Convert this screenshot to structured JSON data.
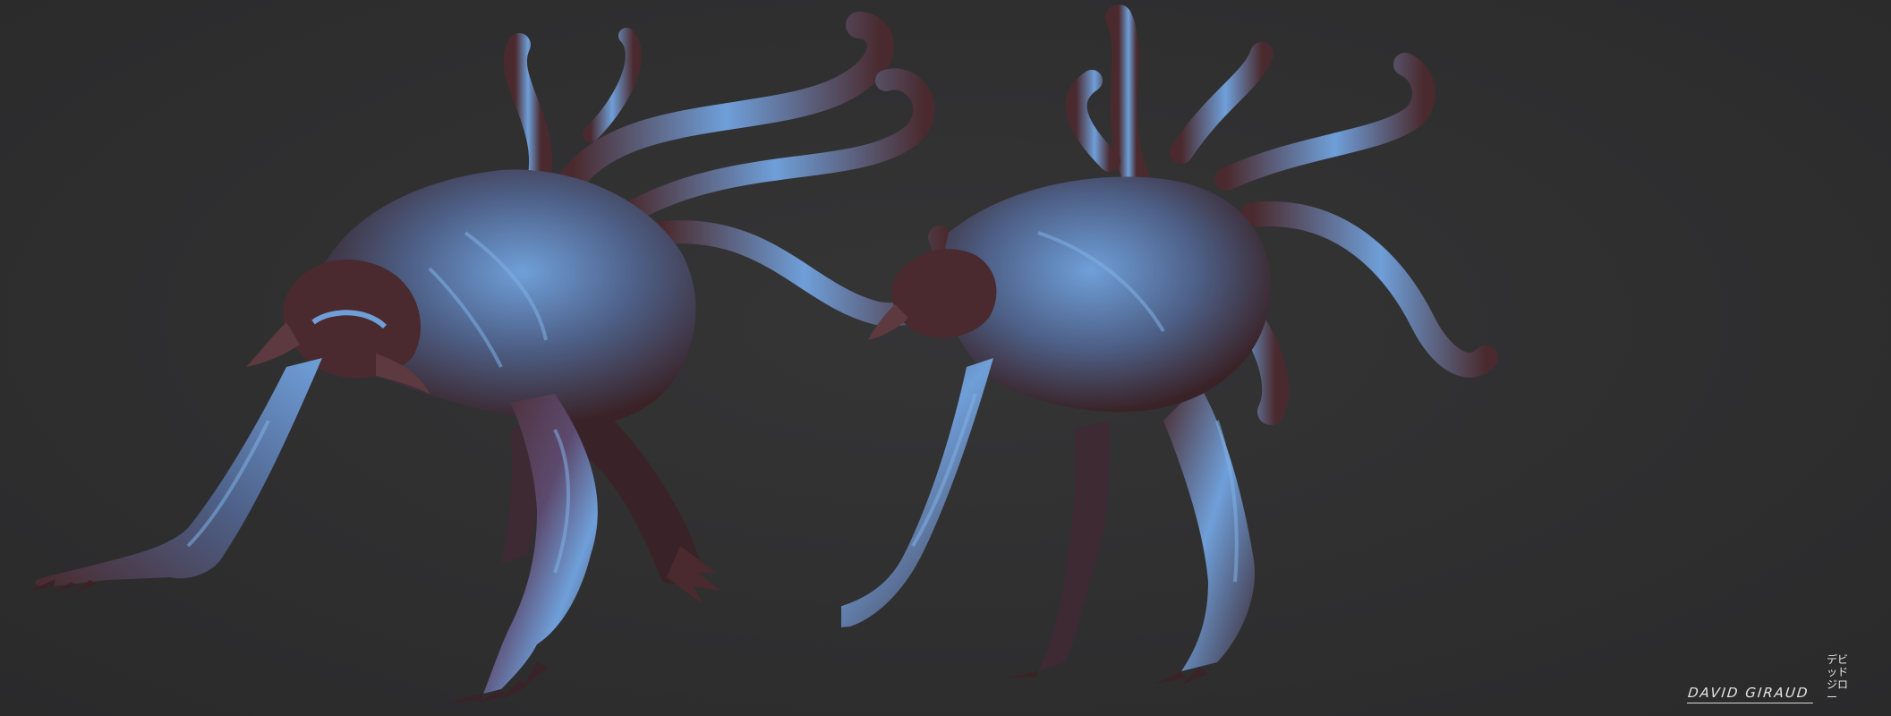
{
  "image": {
    "background_color": "#2e2e2f",
    "subject_colors": {
      "highlight": "#6f9fd9",
      "mid": "#4d5f86",
      "shadow": "#4a2a2e",
      "deep_shadow": "#2b1b1e"
    }
  },
  "signature": {
    "name": "DAVID GIRAUD",
    "japanese_line1": "デビッド",
    "japanese_line2": "ジロー"
  }
}
